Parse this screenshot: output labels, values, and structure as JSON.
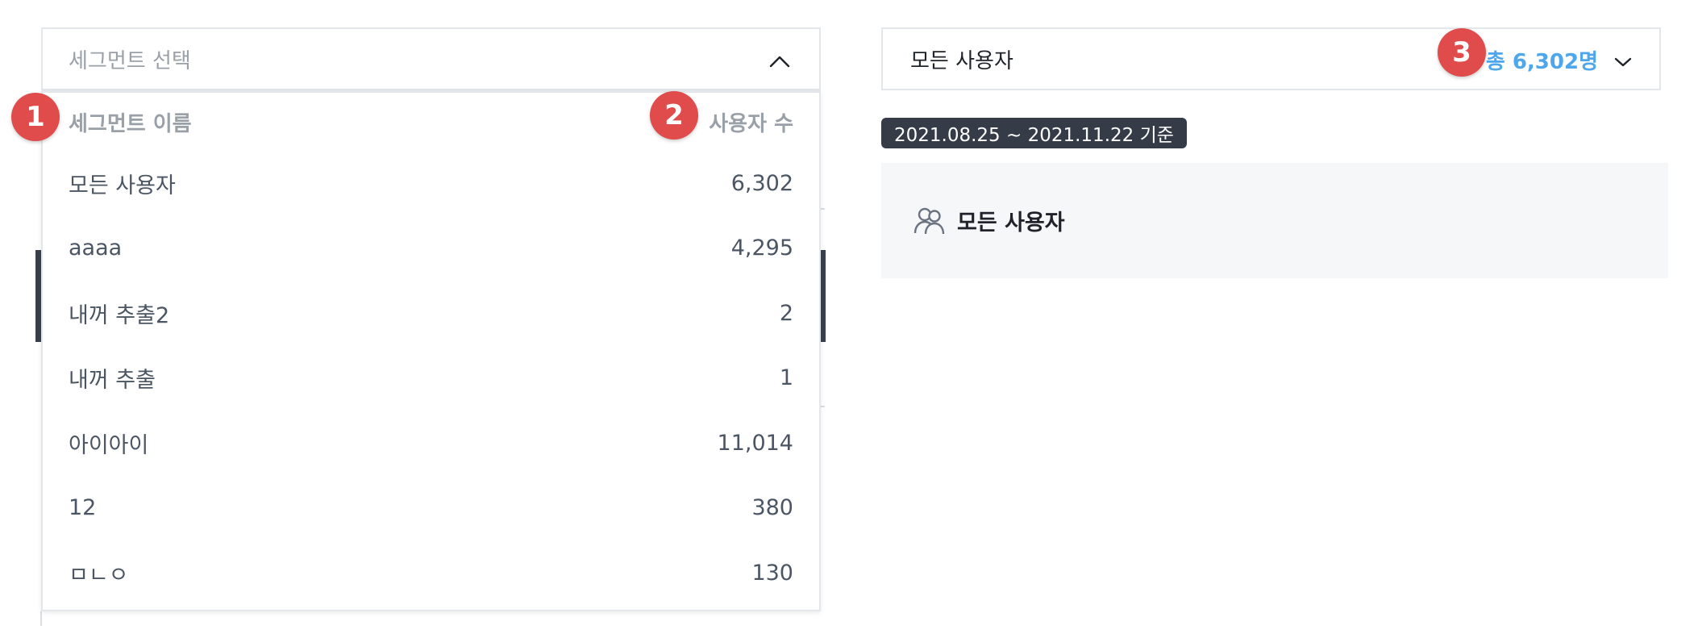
{
  "left_select": {
    "placeholder": "세그먼트 선택",
    "header_name": "세그먼트 이름",
    "header_count": "사용자 수",
    "rows": [
      {
        "name": "모든 사용자",
        "count": "6,302"
      },
      {
        "name": "aaaa",
        "count": "4,295"
      },
      {
        "name": "내꺼 추출2",
        "count": "2"
      },
      {
        "name": "내꺼 추출",
        "count": "1"
      },
      {
        "name": "아이아이",
        "count": "11,014"
      },
      {
        "name": "12",
        "count": "380"
      },
      {
        "name": "ㅁㄴㅇ",
        "count": "130"
      }
    ]
  },
  "right_panel": {
    "selected_segment": "모든 사용자",
    "total_label": "총 6,302명",
    "date_range": "2021.08.25 ~ 2021.11.22 기준",
    "card_title": "모든 사용자",
    "card_icon": "users-icon"
  },
  "markers": {
    "m1": "1",
    "m2": "2",
    "m3": "3"
  },
  "colors": {
    "accent_blue": "#4ea6ec",
    "marker_red": "#e04b4b",
    "badge_dark": "#353c48"
  }
}
